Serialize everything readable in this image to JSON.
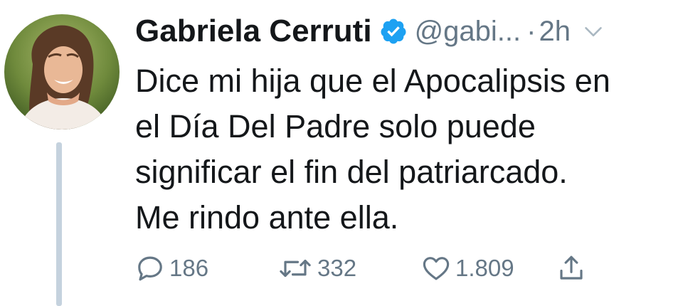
{
  "tweet": {
    "author_name": "Gabriela Cerruti",
    "handle": "@gabi...",
    "separator": "·",
    "timestamp": "2h",
    "text_lines": [
      "Dice mi hija que el Apocalipsis en",
      "el Día Del Padre solo puede",
      "significar el fin del patriarcado.",
      "Me rindo ante ella."
    ]
  },
  "actions": {
    "replies": "186",
    "retweets": "332",
    "likes": "1.809"
  },
  "icons": {
    "verified": "verified-badge-icon",
    "more": "chevron-down-icon",
    "reply": "reply-icon",
    "retweet": "retweet-icon",
    "like": "heart-icon",
    "share": "share-icon"
  },
  "colors": {
    "text": "#14171a",
    "secondary": "#657786",
    "verified_blue": "#1da1f2",
    "thread_line": "#c5d2de"
  }
}
